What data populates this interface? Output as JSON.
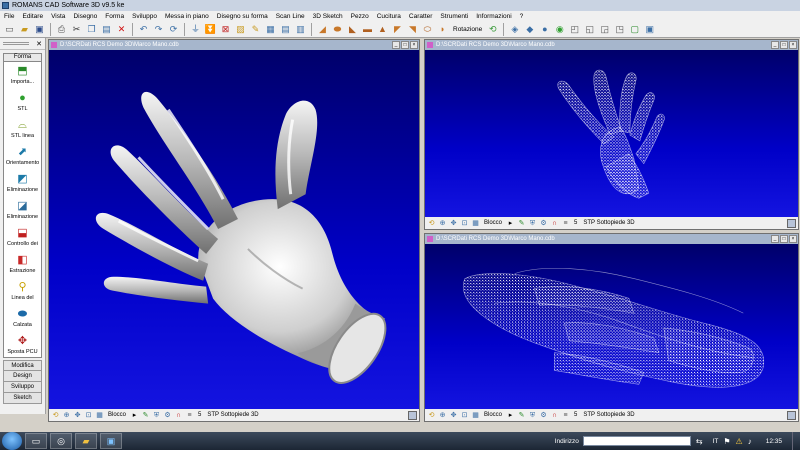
{
  "window": {
    "title": "ROMANS CAD Software 3D v9.5 ke"
  },
  "menu": [
    "File",
    "Editare",
    "Vista",
    "Disegno",
    "Forma",
    "Sviluppo",
    "Messa in piano",
    "Disegno su forma",
    "Scan Line",
    "3D Sketch",
    "Pezzo",
    "Cucitura",
    "Caratter",
    "Strumenti",
    "Informazioni",
    "?"
  ],
  "toolbar": {
    "rotation_label": "Rotazione",
    "icons": [
      "new-icon",
      "open-icon",
      "save-icon",
      "print-icon",
      "cut-icon",
      "copy-icon",
      "paste-icon",
      "delete-icon",
      "undo-icon",
      "redo-icon",
      "shoe-icon",
      "insole-icon",
      "last-icon",
      "boot-icon",
      "heel-icon",
      "cube-icon",
      "sphere-icon",
      "box-view-icon"
    ]
  },
  "left_panel": {
    "header": "Forma",
    "tools": [
      {
        "label": "Importa...",
        "icon": "import-icon",
        "glyph": "⬒",
        "color": "#2a8a2a"
      },
      {
        "label": "STL",
        "icon": "sphere-tool-icon",
        "glyph": "●",
        "color": "#2fa02f"
      },
      {
        "label": "STL linea",
        "icon": "foot-outline-icon",
        "glyph": "⌓",
        "color": "#7a9a20"
      },
      {
        "label": "Orientamento",
        "icon": "orientation-icon",
        "glyph": "⬈",
        "color": "#1c7aa8"
      },
      {
        "label": "Eliminazione",
        "icon": "eliminate-icon",
        "glyph": "◩",
        "color": "#1c7aa8"
      },
      {
        "label": "Eliminazione",
        "icon": "eliminate-part-icon",
        "glyph": "◪",
        "color": "#2a6a9a"
      },
      {
        "label": "Controllo dei",
        "icon": "control-icon",
        "glyph": "⬓",
        "color": "#c02020"
      },
      {
        "label": "Estrazione",
        "icon": "extraction-icon",
        "glyph": "◧",
        "color": "#c82828"
      },
      {
        "label": "Linea del",
        "icon": "line-icon",
        "glyph": "⚲",
        "color": "#c8a000"
      },
      {
        "label": "Calzata",
        "icon": "fitting-icon",
        "glyph": "⬬",
        "color": "#1c6aa8"
      },
      {
        "label": "Sposta PCU",
        "icon": "move-pcu-icon",
        "glyph": "✥",
        "color": "#b02020"
      }
    ],
    "tabs": [
      "Modifica",
      "Design",
      "Sviluppo",
      "Sketch"
    ]
  },
  "views": [
    {
      "title": "D:\\SCRDati RCS Demo 3D\\Marco Mano.cdb",
      "status": "STP Sottopiede 3D",
      "number": "5",
      "block_label": "Blocco"
    },
    {
      "title": "D:\\SCRDati RCS Demo 3D\\Marco Mano.cdb",
      "status": "STP Sottopiede 3D",
      "number": "5",
      "block_label": "Blocco"
    },
    {
      "title": "D:\\SCRDati RCS Demo 3D\\Marco Mano.cdb",
      "status": "STP Sottopiede 3D",
      "number": "5",
      "block_label": "Blocco"
    }
  ],
  "taskbar": {
    "address_label": "Indirizzo",
    "language": "IT",
    "clock": "12:35"
  }
}
